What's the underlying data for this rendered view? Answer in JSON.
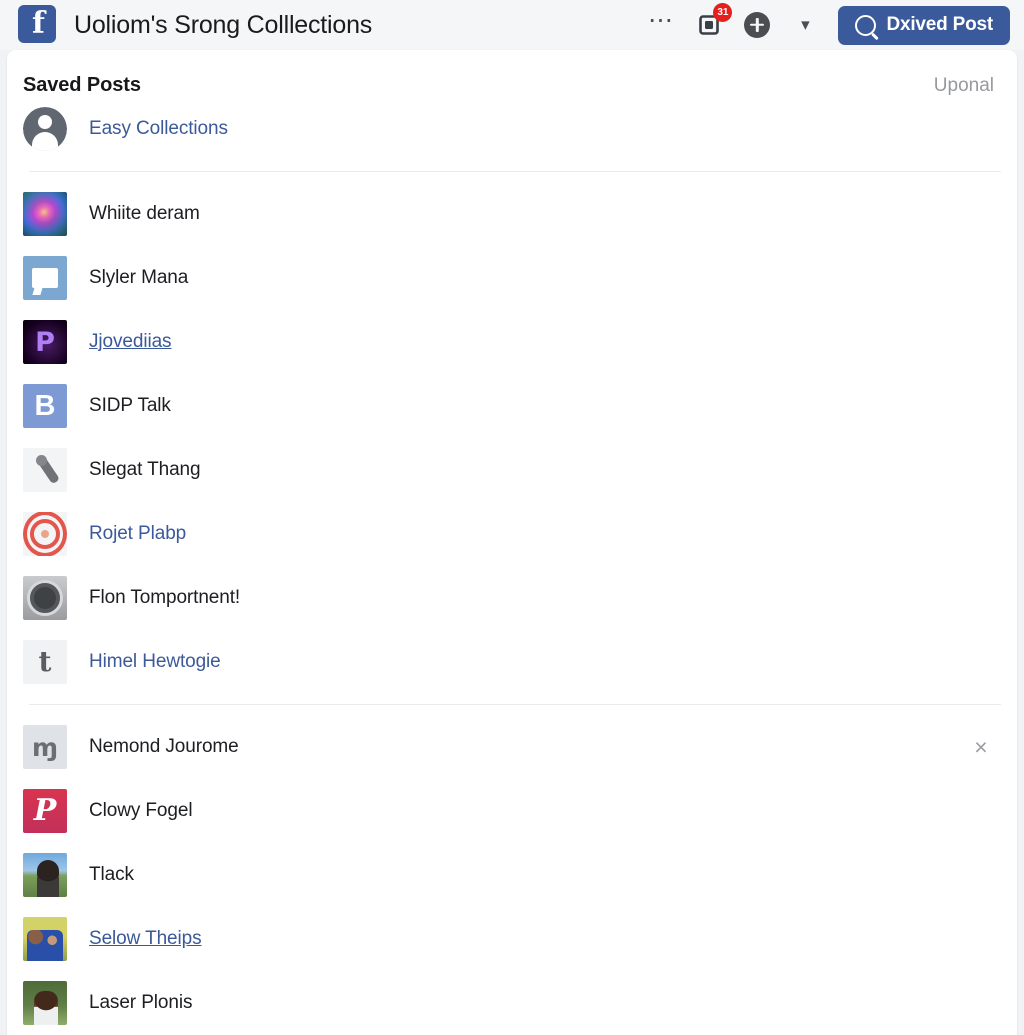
{
  "header": {
    "logo_icon": "facebook-logo-icon",
    "title": "Uoliom's Srong Colllections",
    "more_icon": "ellipsis-icon",
    "messages_icon": "messages-icon",
    "messages_badge": "31",
    "create_icon": "plus-circle-icon",
    "account_icon": "chevron-down-icon",
    "search_icon": "search-icon",
    "primary_button_label": "Dxived Post"
  },
  "card": {
    "title": "Saved Posts",
    "action_label": "Uponal"
  },
  "rows": [
    {
      "label": "Easy Collections",
      "style": "link",
      "icon": "profile-avatar-icon",
      "thumb": "th-avatar",
      "close": false
    },
    {
      "divider": true
    },
    {
      "label": "Whiite deram",
      "style": "plain",
      "icon": "nebula-thumbnail",
      "thumb": "th-nebula",
      "close": false
    },
    {
      "label": "Slyler Mana",
      "style": "plain",
      "icon": "flag-thumbnail",
      "thumb": "th-flag",
      "close": false
    },
    {
      "label": "Jjovediias",
      "style": "link-underline",
      "icon": "purple-p-thumbnail",
      "thumb": "th-dark-p",
      "close": false
    },
    {
      "label": "SIDP Talk",
      "style": "plain",
      "icon": "letter-b-thumbnail",
      "thumb": "th-b",
      "close": false
    },
    {
      "label": "Slegat Thang",
      "style": "plain",
      "icon": "microphone-thumbnail",
      "thumb": "th-mic",
      "close": false
    },
    {
      "label": "Rojet Plabp",
      "style": "link",
      "icon": "target-thumbnail",
      "thumb": "th-target",
      "close": false
    },
    {
      "label": "Flon Tomportnent!",
      "style": "plain",
      "icon": "camera-thumbnail",
      "thumb": "th-cam",
      "close": false
    },
    {
      "label": "Himel Hewtogie",
      "style": "link",
      "icon": "tumblr-t-thumbnail",
      "thumb": "th-t",
      "close": false
    },
    {
      "divider": true
    },
    {
      "label": "Nemond Jourome",
      "style": "plain",
      "icon": "glyph-thumbnail",
      "thumb": "th-glyph",
      "close": true,
      "close_icon": "close-icon",
      "close_glyph": "×"
    },
    {
      "label": "Clowy Fogel",
      "style": "plain",
      "icon": "pinterest-thumbnail",
      "thumb": "th-pin",
      "close": false
    },
    {
      "label": "Tlack",
      "style": "plain",
      "icon": "person-photo-thumbnail",
      "thumb": "th-photo1",
      "close": false
    },
    {
      "label": "Selow Theips",
      "style": "link-underline",
      "icon": "couple-photo-thumbnail",
      "thumb": "th-photo2",
      "close": false
    },
    {
      "label": "Laser Plonis",
      "style": "plain",
      "icon": "man-photo-thumbnail",
      "thumb": "th-photo3",
      "close": false
    }
  ],
  "colors": {
    "facebook_blue": "#3a5a9b",
    "link_blue": "#3c5a99",
    "badge_red": "#e4201c",
    "page_bg": "#f0f2f5",
    "card_bg": "#ffffff",
    "muted_text": "#97999c"
  }
}
